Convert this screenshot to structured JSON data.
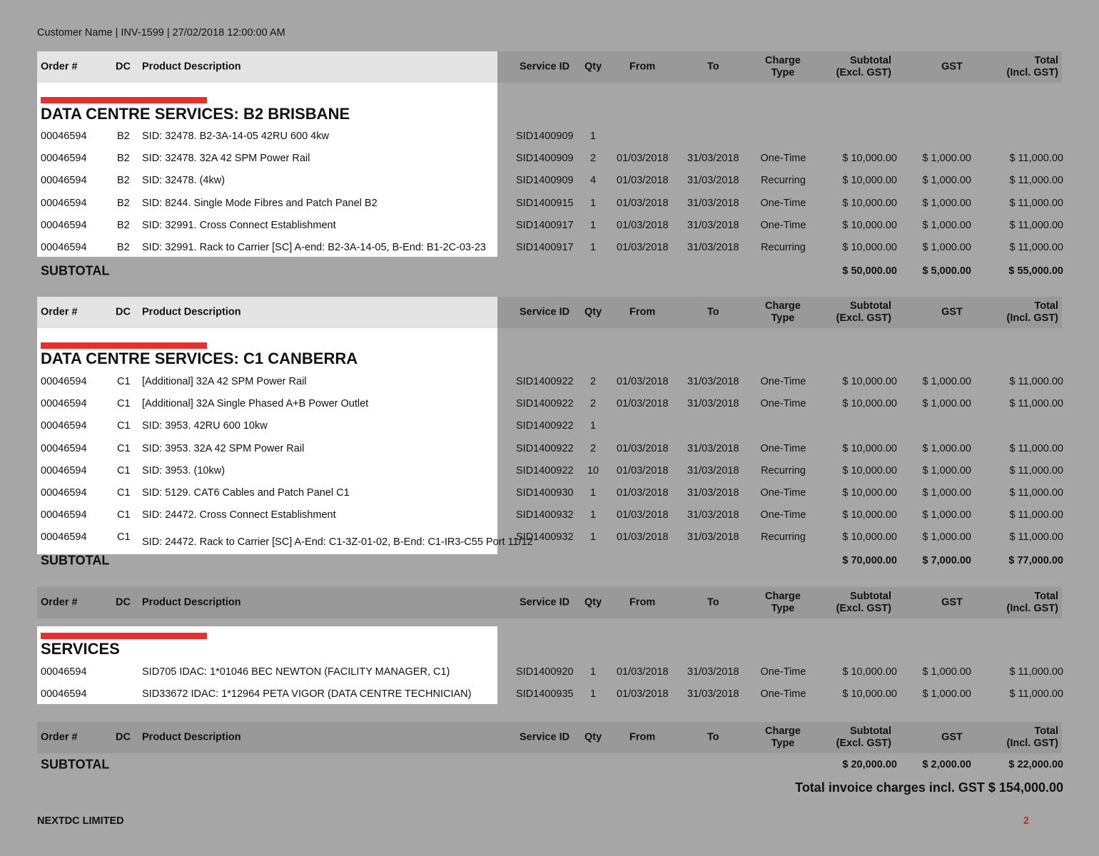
{
  "page_header": "Customer Name | INV-1599 | 27/02/2018 12:00:00 AM",
  "columns": {
    "order": "Order #",
    "dc": "DC",
    "desc": "Product Description",
    "sid": "Service ID",
    "qty": "Qty",
    "from": "From",
    "to": "To",
    "charge": [
      "Charge",
      "Type"
    ],
    "subtotal": [
      "Subtotal",
      "(Excl. GST)"
    ],
    "gst": "GST",
    "total": [
      "Total",
      "(Incl. GST)"
    ]
  },
  "subtotal_label": "SUBTOTAL",
  "sections": [
    {
      "title": "DATA CENTRE SERVICES: B2 BRISBANE",
      "rows": [
        [
          "00046594",
          "B2",
          "SID: 32478. B2-3A-14-05 42RU 600 4kw",
          "SID1400909",
          "1",
          "",
          "",
          "",
          "",
          "",
          ""
        ],
        [
          "00046594",
          "B2",
          "SID: 32478. 32A 42 SPM Power Rail",
          "SID1400909",
          "2",
          "01/03/2018",
          "31/03/2018",
          "One-Time",
          "$ 10,000.00",
          "$ 1,000.00",
          "$ 11,000.00"
        ],
        [
          "00046594",
          "B2",
          "SID: 32478. (4kw)",
          "SID1400909",
          "4",
          "01/03/2018",
          "31/03/2018",
          "Recurring",
          "$ 10,000.00",
          "$ 1,000.00",
          "$ 11,000.00"
        ],
        [
          "00046594",
          "B2",
          "SID: 8244. Single Mode Fibres and Patch Panel B2",
          "SID1400915",
          "1",
          "01/03/2018",
          "31/03/2018",
          "One-Time",
          "$ 10,000.00",
          "$ 1,000.00",
          "$ 11,000.00"
        ],
        [
          "00046594",
          "B2",
          "SID: 32991. Cross Connect Establishment",
          "SID1400917",
          "1",
          "01/03/2018",
          "31/03/2018",
          "One-Time",
          "$ 10,000.00",
          "$ 1,000.00",
          "$ 11,000.00"
        ],
        [
          "00046594",
          "B2",
          "SID: 32991. Rack to Carrier [SC]  A-end: B2-3A-14-05, B-End: B1-2C-03-23",
          "SID1400917",
          "1",
          "01/03/2018",
          "31/03/2018",
          "Recurring",
          "$ 10,000.00",
          "$ 1,000.00",
          "$ 11,000.00"
        ]
      ],
      "subtotal": {
        "subtotal": "$ 50,000.00",
        "gst": "$ 5,000.00",
        "total": "$ 55,000.00"
      }
    },
    {
      "title": "DATA CENTRE SERVICES: C1 CANBERRA",
      "rows": [
        [
          "00046594",
          "C1",
          "[Additional] 32A 42 SPM Power Rail",
          "SID1400922",
          "2",
          "01/03/2018",
          "31/03/2018",
          "One-Time",
          "$ 10,000.00",
          "$ 1,000.00",
          "$ 11,000.00"
        ],
        [
          "00046594",
          "C1",
          "[Additional] 32A Single Phased A+B Power Outlet",
          "SID1400922",
          "2",
          "01/03/2018",
          "31/03/2018",
          "One-Time",
          "$ 10,000.00",
          "$ 1,000.00",
          "$ 11,000.00"
        ],
        [
          "00046594",
          "C1",
          "SID: 3953. 42RU 600 10kw",
          "SID1400922",
          "1",
          "",
          "",
          "",
          "",
          "",
          ""
        ],
        [
          "00046594",
          "C1",
          "SID: 3953. 32A 42 SPM Power Rail",
          "SID1400922",
          "2",
          "01/03/2018",
          "31/03/2018",
          "One-Time",
          "$ 10,000.00",
          "$ 1,000.00",
          "$ 11,000.00"
        ],
        [
          "00046594",
          "C1",
          "SID: 3953. (10kw)",
          "SID1400922",
          "10",
          "01/03/2018",
          "31/03/2018",
          "Recurring",
          "$ 10,000.00",
          "$ 1,000.00",
          "$ 11,000.00"
        ],
        [
          "00046594",
          "C1",
          "SID: 5129. CAT6 Cables and Patch Panel C1",
          "SID1400930",
          "1",
          "01/03/2018",
          "31/03/2018",
          "One-Time",
          "$ 10,000.00",
          "$ 1,000.00",
          "$ 11,000.00"
        ],
        [
          "00046594",
          "C1",
          "SID: 24472. Cross Connect Establishment",
          "SID1400932",
          "1",
          "01/03/2018",
          "31/03/2018",
          "One-Time",
          "$ 10,000.00",
          "$ 1,000.00",
          "$ 11,000.00"
        ],
        [
          "00046594",
          "C1",
          "SID: 24472. Rack to Carrier [SC] A-End: C1-3Z-01-02, B-End: C1-IR3-C55 Port 11/12",
          "SID1400932",
          "1",
          "01/03/2018",
          "31/03/2018",
          "Recurring",
          "$ 10,000.00",
          "$ 1,000.00",
          "$ 11,000.00"
        ]
      ],
      "subtotal": {
        "subtotal": "$ 70,000.00",
        "gst": "$ 7,000.00",
        "total": "$ 77,000.00"
      }
    },
    {
      "title": "SERVICES",
      "rows": [
        [
          "00046594",
          "",
          "SID705 IDAC: 1*01046 BEC NEWTON (FACILITY MANAGER, C1)",
          "SID1400920",
          "1",
          "01/03/2018",
          "31/03/2018",
          "One-Time",
          "$ 10,000.00",
          "$ 1,000.00",
          "$ 11,000.00"
        ],
        [
          "00046594",
          "",
          "SID33672 IDAC: 1*12964 PETA VIGOR (DATA CENTRE TECHNICIAN)",
          "SID1400935",
          "1",
          "01/03/2018",
          "31/03/2018",
          "One-Time",
          "$ 10,000.00",
          "$ 1,000.00",
          "$ 11,000.00"
        ]
      ],
      "subtotal": {
        "subtotal": "$ 20,000.00",
        "gst": "$ 2,000.00",
        "total": "$ 22,000.00"
      }
    }
  ],
  "grand_total": "Total invoice charges incl. GST $ 154,000.00",
  "footer": {
    "company": "NEXTDC LIMITED",
    "page_number": "2"
  },
  "colors": {
    "accent_red": "#e3312d",
    "background": "#a6a6a6",
    "header_dark": "#999999",
    "header_light": "#e4e4e4"
  }
}
